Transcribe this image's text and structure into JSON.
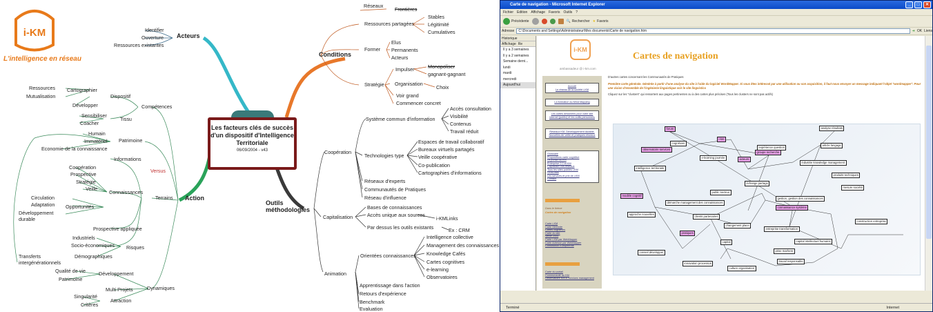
{
  "logo": {
    "name": "i-KM",
    "tagline": "L'intelligence en réseau"
  },
  "central": {
    "title": "Les facteurs clés de succès d'un dispositif d'Intelligence Territoriale",
    "date": "06/09/2004 - v43"
  },
  "branches": {
    "acteurs": "Acteurs",
    "action": "Action",
    "conditions": "Conditions",
    "outils": "Outils méthodologies"
  },
  "acteurs_children": [
    "Identifier",
    "Ouverture",
    "Ressources existantes"
  ],
  "action_left": {
    "competences": "Compétences",
    "cartographier": "Cartographier",
    "dispositif": "Dispositif",
    "ressources": "Ressources",
    "mutualisation": "Mutualisation",
    "developper": "Développer",
    "tissu": "Tissu",
    "sensibiliser": "Sensibiliser",
    "coacher": "Coacher",
    "patrimoine": "Patrimoine",
    "humain": "Humain",
    "immateriel": "Immatériel",
    "economie": "Economie de la connaissance",
    "informations": "Informations",
    "versus": "Versus",
    "connaissances": "Connaissances",
    "terrains": "Terrains",
    "cooperation": "Coopération",
    "prospective": "Prospective",
    "strategie": "Stratégie",
    "veille": "Veille",
    "opportunites": "Opportunités",
    "circulation": "Circulation",
    "adaptation": "Adaptation",
    "developpement_durable": "Développement durable",
    "prospective_appliquee": "Prospective appliquée",
    "risques": "Risques",
    "industriels": "Industriels",
    "socio": "Socio-économiques",
    "demographiques": "Démographiques",
    "transferts": "Transferts intergénérationnels",
    "dynamiques": "Dynamiques",
    "developpement": "Développement",
    "qualite": "Qualité de vie",
    "patrimoine2": "Patrimoine",
    "multi": "Multi Projets",
    "attraction": "Attraction",
    "singularite": "Singularité",
    "criteres": "Critères"
  },
  "conditions_children": {
    "reseaux": "Réseaux",
    "frontieres": "Frontières",
    "ressources_partagees": "Ressources partagées",
    "stables": "Stables",
    "legitimite": "Légitimité",
    "cumulatives": "Cumulatives",
    "former": "Former",
    "elus": "Elus",
    "permanents": "Permanents",
    "acteurs": "Acteurs",
    "strategie": "Stratégie",
    "impulser": "Impulser",
    "monopoliser": "Monopoliser",
    "gagnant": "gagnant-gagnant",
    "organisation": "Organisation",
    "choix": "Choix",
    "voir": "Voir grand",
    "commencer": "Commencer concret"
  },
  "outils_children": {
    "cooperation": "Coopération",
    "systeme": "Système commun d'information",
    "acces": "Accès consultation",
    "visibilite": "Visibilité",
    "contenus": "Contenus",
    "travail": "Travail réduit",
    "technologies": "Technologies type",
    "espaces": "Espaces de travail collaboratif",
    "bureaux": "Bureaux virtuels partagés",
    "veille": "Veille coopérative",
    "copub": "Co-publication",
    "carto": "Cartographies d'informations",
    "experts": "Réseaux d'experts",
    "communautes": "Communautés de Pratiques",
    "influence": "Réseau d'influence",
    "capitalisation": "Capitalisation",
    "bases": "Bases de connaissances",
    "acces_sources": "Accès unique aux sources",
    "ikmlinks": "i-KMLinks",
    "outils_existants": "Par dessus les outils existants",
    "crm": "Ex : CRM",
    "animation": "Animation",
    "orientees": "Orientées connaissances",
    "intelligence": "Intelligence collective",
    "management": "Management des connaissances",
    "cafes": "Knowledge Cafés",
    "cartes": "Cartes cognitives",
    "elearning": "e-learning",
    "observatoires": "Observatoires",
    "apprentissage": "Apprentissage dans l'action",
    "retours": "Retours d'expérience",
    "benchmark": "Benchmark",
    "evaluation": "Evaluation"
  },
  "browser": {
    "title": "Carte de navigation - Microsoft Internet Explorer",
    "menu": [
      "Fichier",
      "Edition",
      "Affichage",
      "Favoris",
      "Outils",
      "?"
    ],
    "toolbar": {
      "back": "Précédente",
      "search": "Rechercher",
      "favorites": "Favoris"
    },
    "address_label": "Adresse",
    "address": "C:\\Documents and Settings\\Administrateur\\Mes documents\\Carte de navigation.htm",
    "ok": "OK",
    "links": "Liens",
    "history_title": "Historique",
    "history_view": "Affichage",
    "history_search": "Re",
    "history_items": [
      "Il y a 3 semaines",
      "Il y a 2 semaines",
      "Semaine derni...",
      "lundi",
      "mardi",
      "mercredi",
      "Aujourd'hui"
    ],
    "status_left": "Terminé",
    "status_right": "Internet"
  },
  "page": {
    "logo": "i-KM",
    "title": "Cartes de navigation",
    "email": "ambassadeur @ i-km.com",
    "left_boxes": [
      "Accueil\nLe réseau de la société i-KM",
      "La formation au Mind Mapping",
      "Les cartes dessinées pour votre site internet (public) et les outils personnels",
      "Réseaux KM, Développement durable, Nouvelles de veille et pratiques réseaux",
      "Glossaire\nPropositions carte cognitive\nLe portail du KM\nEnterprise 2.0 et KM\nCapitaliser vos réseaux\nTous les sites publiés i-KM\ni-KMLinks\nLes services et prix de i-KM\nContact"
    ],
    "dans_theme": "Dans le thème",
    "cartes_nav": "Cartes de navigation",
    "left_links": [
      "Carte i-KM",
      "Carte Méthode",
      "Cartes cognitives",
      "Carte du site",
      "Vente 2004",
      "Carte i-KM par WebMapper",
      "Carte Adresse par WebMapper",
      "Constitution Européenne"
    ],
    "left_links2": [
      "Carte du portail",
      "Communauté du KM",
      "Observatoire KM & Services management"
    ],
    "intro1": "D'autres cartes concernant les Communautés de Pratiques",
    "intro2": "Première carte générale. Générée à partir d'une analyse du site à l'aide du logiciel WordMapper. Si vous êtes intéressé par une utilisation ou son acquisition, il faut nous envoyer un message indiquant l'objet \"wordmapper\". Pour une vision d'ensemble de l'ingénierie linguistique voir le site lingvistics",
    "intro3": "Cliquez sur les \"clusters\" qui ressortent aux pages pertinentes ou à des cartes plus précises (Tous les clusters ne sont pas actifs)",
    "map_nodes": [
      "forum",
      "i-km",
      "cognitives",
      "expérience question",
      "analyse résultats",
      "acteurs",
      "article langage",
      "observatoire services",
      "groupe recherche",
      "e-learning journée",
      "industrie knowledge management",
      "intelligence territoriale",
      "produits techniques",
      "échange partage",
      "mesure société",
      "gestion, gestion des connaissances",
      "public secteur",
      "démarche management des connaissances",
      "modèle cognitif",
      "connaissance système",
      "approche nouvelles",
      "clients partenaires",
      "construction entreprise",
      "changement place",
      "entreprise transformation",
      "pratiques",
      "capital",
      "capital intellectuel humains",
      "conseil développer",
      "prise marhere",
      "travail responsable",
      "innovation processus",
      "culture organisation"
    ]
  }
}
